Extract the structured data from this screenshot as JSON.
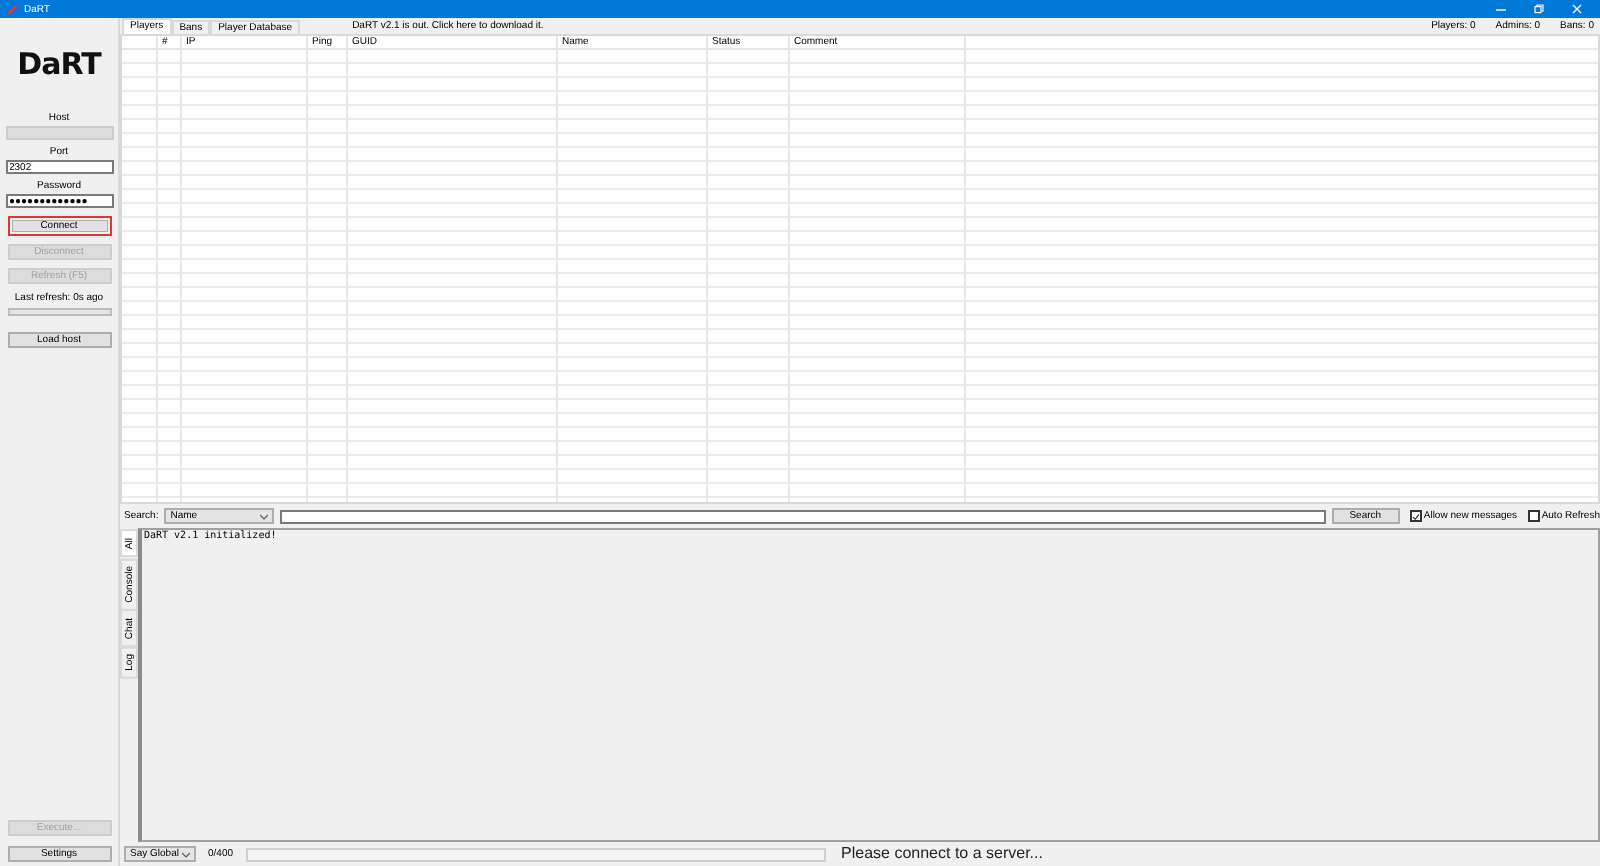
{
  "window": {
    "title": "DaRT"
  },
  "sidebar": {
    "logo": "DaRT",
    "host_label": "Host",
    "host_field": {
      "disabled": true
    },
    "port_label": "Port",
    "port": "2302",
    "password_label": "Password",
    "password": "●●●●●●●●●●●●●",
    "buttons": [
      {
        "label": "Connect",
        "disabled": false,
        "highlighted": true
      },
      {
        "label": "Disconnect",
        "disabled": true,
        "highlighted": false
      },
      {
        "label": "Refresh (F5)",
        "disabled": true,
        "highlighted": false
      }
    ],
    "last_refresh": "Last refresh: 0s ago",
    "refresh_progress": {
      "level": 0
    },
    "load_host": "Load host",
    "bottom_buttons": [
      {
        "label": "Execute...",
        "disabled": true
      },
      {
        "label": "Settings",
        "disabled": false
      }
    ]
  },
  "tabs": [
    {
      "label": "Players",
      "selected": true
    },
    {
      "label": "Bans",
      "selected": false
    },
    {
      "label": "Player Database",
      "selected": false
    }
  ],
  "update_notice": "DaRT v2.1 is out. Click here to download it.",
  "counts": [
    "Players: 0",
    "Admins: 0",
    "Bans: 0"
  ],
  "table": {
    "columns": [
      "#",
      "IP",
      "Ping",
      "GUID",
      "Name",
      "Status",
      "Comment"
    ]
  },
  "search": {
    "label": "Search:",
    "field": "Name",
    "button": "Search",
    "options": [
      {
        "label": "Allow new messages",
        "checked": true
      },
      {
        "label": "Auto Refresh",
        "checked": false
      }
    ]
  },
  "log_tabs": [
    {
      "label": "All",
      "selected": true
    },
    {
      "label": "Console",
      "selected": false
    },
    {
      "label": "Chat",
      "selected": false
    },
    {
      "label": "Log",
      "selected": false
    }
  ],
  "log_lines": [
    "DaRT v2.1 initialized!"
  ],
  "status_bar": {
    "say_mode": "Say Global",
    "counter": "0/400",
    "status": "Please connect to a server..."
  }
}
